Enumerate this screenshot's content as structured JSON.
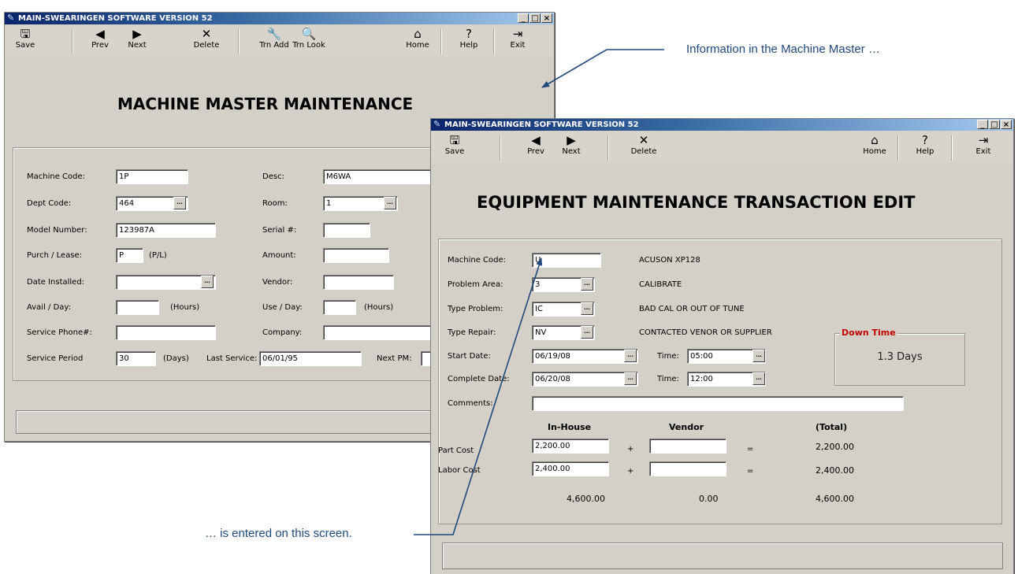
{
  "window1": {
    "title": "MAIN-SWEARINGEN SOFTWARE VERSION 52",
    "title_buttons": [
      "_",
      "□",
      "×"
    ],
    "toolbar": {
      "save": "Save",
      "prev": "Prev",
      "next": "Next",
      "delete": "Delete",
      "trn_add": "Trn Add",
      "trn_look": "Trn Look",
      "home": "Home",
      "help": "Help",
      "exit": "Exit"
    },
    "heading": "MACHINE MASTER MAINTENANCE",
    "form": {
      "machine_code_label": "Machine Code:",
      "machine_code": "1P",
      "desc_label": "Desc:",
      "desc": "M6WA",
      "dept_code_label": "Dept Code:",
      "dept_code": "464",
      "room_label": "Room:",
      "room": "1",
      "model_number_label": "Model Number:",
      "model_number": "123987A",
      "serial_label": "Serial #:",
      "serial": "",
      "purch_lease_label": "Purch / Lease:",
      "purch_lease": "P",
      "purch_lease_hint": "(P/L)",
      "amount_label": "Amount:",
      "amount": "",
      "date_installed_label": "Date Installed:",
      "date_installed": "",
      "vendor_label": "Vendor:",
      "vendor": "",
      "avail_day_label": "Avail / Day:",
      "avail_day": "",
      "avail_hint": "(Hours)",
      "use_day_label": "Use / Day:",
      "use_day": "",
      "use_hint": "(Hours)",
      "service_phone_label": "Service Phone#:",
      "service_phone": "",
      "company_label": "Company:",
      "company": "",
      "service_period_label": "Service Period",
      "service_period": "30",
      "service_period_hint": "(Days)",
      "last_service_label": "Last Service:",
      "last_service": "06/01/95",
      "next_pm_label": "Next PM:"
    }
  },
  "window2": {
    "title": "MAIN-SWEARINGEN SOFTWARE VERSION 52",
    "title_buttons": [
      "_",
      "□",
      "×"
    ],
    "toolbar": {
      "save": "Save",
      "prev": "Prev",
      "next": "Next",
      "delete": "Delete",
      "home": "Home",
      "help": "Help",
      "exit": "Exit"
    },
    "heading": "EQUIPMENT MAINTENANCE TRANSACTION EDIT",
    "form": {
      "machine_code_label": "Machine Code:",
      "machine_code": "U",
      "machine_desc": "ACUSON XP128",
      "problem_area_label": "Problem Area:",
      "problem_area": "3",
      "problem_area_desc": "CALIBRATE",
      "type_problem_label": "Type Problem:",
      "type_problem": "IC",
      "type_problem_desc": "BAD CAL OR OUT OF TUNE",
      "type_repair_label": "Type Repair:",
      "type_repair": "NV",
      "type_repair_desc": "CONTACTED VENOR OR SUPPLIER",
      "start_date_label": "Start Date:",
      "start_date": "06/19/08",
      "start_time_label": "Time:",
      "start_time": "05:00",
      "complete_date_label": "Complete Date:",
      "complete_date": "06/20/08",
      "complete_time_label": "Time:",
      "complete_time": "12:00",
      "comments_label": "Comments:",
      "comments": "",
      "down_time_title": "Down Time",
      "down_time_value": "1.3 Days",
      "col_inhouse": "In-House",
      "col_vendor": "Vendor",
      "col_total": "(Total)",
      "part_cost_label": "Part Cost",
      "part_cost_inhouse": "2,200.00",
      "part_cost_vendor": "",
      "part_cost_total": "2,200.00",
      "labor_cost_label": "Labor Cost",
      "labor_cost_inhouse": "2,400.00",
      "labor_cost_vendor": "",
      "labor_cost_total": "2,400.00",
      "plus": "+",
      "equals": "=",
      "sum_inhouse": "4,600.00",
      "sum_vendor": "0.00",
      "sum_total": "4,600.00"
    }
  },
  "annotations": {
    "top": "Information in the Machine Master …",
    "bottom": "… is entered on this screen."
  },
  "colors": {
    "annotation": "#1f497d",
    "window_bg": "#d4d0c8",
    "down_time_title": "#c00000"
  }
}
